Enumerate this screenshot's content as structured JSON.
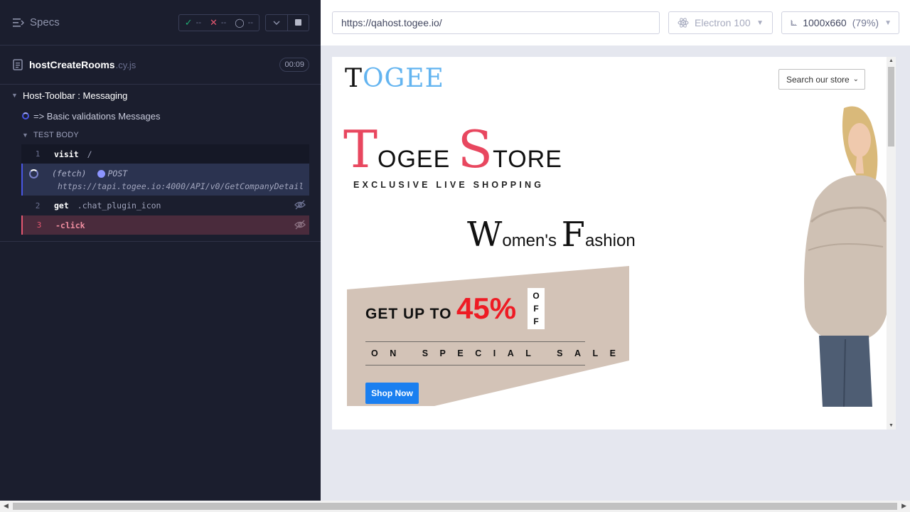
{
  "reporter": {
    "specs_label": "Specs",
    "stats": {
      "passed": "--",
      "failed": "--",
      "pending": "--"
    },
    "spec": {
      "name": "hostCreateRooms",
      "ext": ".cy.js",
      "duration": "00:09"
    },
    "suite_title": "Host-Toolbar : Messaging",
    "test_title": "=> Basic validations Messages",
    "body_label": "TEST BODY",
    "commands": [
      {
        "num": "1",
        "name": "visit",
        "message": "/"
      },
      {
        "name": "(fetch)",
        "method": "POST",
        "url": "https://tapi.togee.io:4000/API/v0/GetCompanyDetail"
      },
      {
        "num": "2",
        "name": "get",
        "message": ".chat_plugin_icon"
      },
      {
        "num": "3",
        "name": "-click",
        "message": ""
      }
    ]
  },
  "aut_header": {
    "url": "https://qahost.togee.io/",
    "browser": "Electron 100",
    "viewport": "1000x660",
    "scale": "(79%)"
  },
  "site": {
    "logo_first": "T",
    "logo_rest": "OGEE",
    "store_select": "Search our store",
    "title": {
      "t": "T",
      "ogee": "OGEE",
      "s": "S",
      "tore": "TORE"
    },
    "subtitle": "EXCLUSIVE LIVE SHOPPING",
    "womens": {
      "w": "W",
      "omens": "omen's",
      "f": "F",
      "ashion": "ashion"
    },
    "promo": {
      "get_up_to": "GET UP TO",
      "percent": "45%",
      "off": [
        "O",
        "F",
        "F"
      ],
      "sale": "ON SPECIAL SALE",
      "shop_now": "Shop Now"
    }
  },
  "colors": {
    "reporter_bg": "#1b1e2e",
    "accent": "#4956e3",
    "fail": "#e45770",
    "pass": "#1fa971",
    "store_red": "#e8475f",
    "logo_blue": "#63b4f0",
    "promo_beige": "#d3c3b7",
    "shop_blue": "#1a7ff0"
  }
}
